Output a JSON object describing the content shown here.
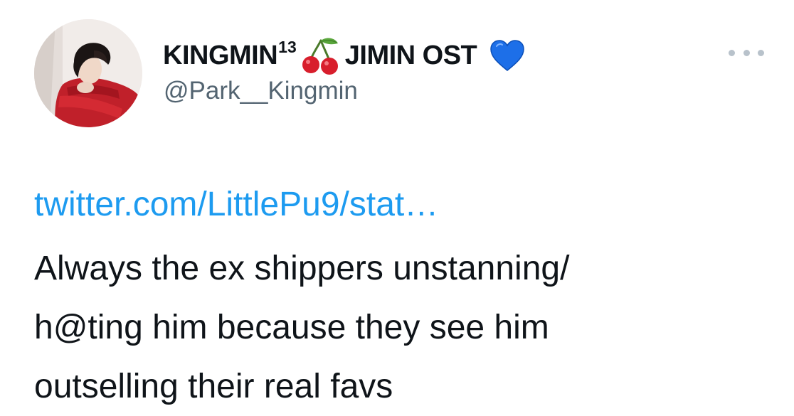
{
  "tweet": {
    "author": {
      "display_name": "KINGMIN",
      "superscript": "13",
      "name_suffix": "JIMIN OST",
      "emoji_1": "cherry-emoji",
      "emoji_2": "blue-heart-emoji",
      "handle": "@Park__Kingmin"
    },
    "link_text": "twitter.com/LittlePu9/stat…",
    "text_lines": [
      "Always the ex shippers unstanning/",
      "h@ting him because they see him",
      "outselling their real favs"
    ],
    "more_icon": "more-horizontal-icon",
    "colors": {
      "link": "#1d9bf0",
      "text": "#0f1419",
      "secondary": "#536471",
      "heart": "#1d6fe8",
      "cherry": "#d81e2c"
    }
  }
}
